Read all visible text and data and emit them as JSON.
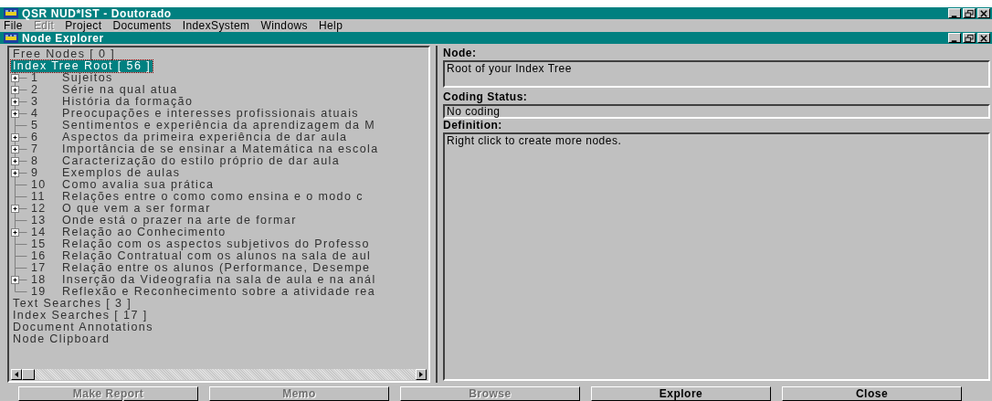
{
  "app_window": {
    "title": "QSR NUD*IST - Doutorado"
  },
  "menu": [
    {
      "label": "File",
      "disabled": false
    },
    {
      "label": "Edit",
      "disabled": true
    },
    {
      "label": "Project",
      "disabled": false
    },
    {
      "label": "Documents",
      "disabled": false
    },
    {
      "label": "IndexSystem",
      "disabled": false
    },
    {
      "label": "Windows",
      "disabled": false
    },
    {
      "label": "Help",
      "disabled": false
    }
  ],
  "explorer_window": {
    "title": "Node Explorer"
  },
  "tree": {
    "top_items": [
      {
        "label": "Free Nodes [ 0 ]",
        "selected": false
      },
      {
        "label": "Index Tree Root [ 56 ]",
        "selected": true
      }
    ],
    "nodes": [
      {
        "kind": "branch",
        "number": "1",
        "label": "Sujeitos"
      },
      {
        "kind": "branch",
        "number": "2",
        "label": "Série na qual atua"
      },
      {
        "kind": "branch",
        "number": "3",
        "label": "História da formação"
      },
      {
        "kind": "branch",
        "number": "4",
        "label": "Preocupações e interesses profissionais atuais"
      },
      {
        "kind": "leaf",
        "number": "5",
        "label": "Sentimentos e experiência da aprendizagem da M"
      },
      {
        "kind": "branch",
        "number": "6",
        "label": "Aspectos da primeira experiência de dar aula"
      },
      {
        "kind": "branch",
        "number": "7",
        "label": "Importância de se ensinar a Matemática na escola"
      },
      {
        "kind": "branch",
        "number": "8",
        "label": "Caracterização do estilo próprio de dar aula"
      },
      {
        "kind": "branch",
        "number": "9",
        "label": "Exemplos de aulas"
      },
      {
        "kind": "leaf",
        "number": "10",
        "label": "Como avalia sua prática"
      },
      {
        "kind": "leaf",
        "number": "11",
        "label": "Relações entre o como como ensina e o modo c"
      },
      {
        "kind": "branch",
        "number": "12",
        "label": "O que vem a ser formar"
      },
      {
        "kind": "leaf",
        "number": "13",
        "label": "Onde está o prazer na arte de formar"
      },
      {
        "kind": "branch",
        "number": "14",
        "label": "Relação ao Conhecimento"
      },
      {
        "kind": "leaf",
        "number": "15",
        "label": "Relação com os aspectos subjetivos do Professo"
      },
      {
        "kind": "leaf",
        "number": "16",
        "label": "Relação Contratual com os alunos na sala de aul"
      },
      {
        "kind": "leaf",
        "number": "17",
        "label": "Relação entre os alunos (Performance, Desempe"
      },
      {
        "kind": "branch",
        "number": "18",
        "label": "Inserção da Videografia na sala de aula e na anál"
      },
      {
        "kind": "last",
        "number": "19",
        "label": "Reflexão e Reconhecimento sobre a atividade rea"
      }
    ],
    "bottom_items": [
      {
        "label": "Text Searches [ 3 ]"
      },
      {
        "label": "Index Searches [ 17 ]"
      },
      {
        "label": "Document Annotations"
      },
      {
        "label": "Node Clipboard"
      }
    ]
  },
  "details": {
    "node_label": "Node:",
    "node_value": "Root of your Index Tree",
    "coding_label": "Coding Status:",
    "coding_value": "No coding",
    "definition_label": "Definition:",
    "definition_value": "Right click to create more nodes."
  },
  "buttons": [
    {
      "label": "Make Report",
      "disabled": true
    },
    {
      "label": "Memo",
      "disabled": true
    },
    {
      "label": "Browse",
      "disabled": true
    },
    {
      "label": "Explore",
      "disabled": false
    },
    {
      "label": "Close",
      "disabled": false
    }
  ]
}
